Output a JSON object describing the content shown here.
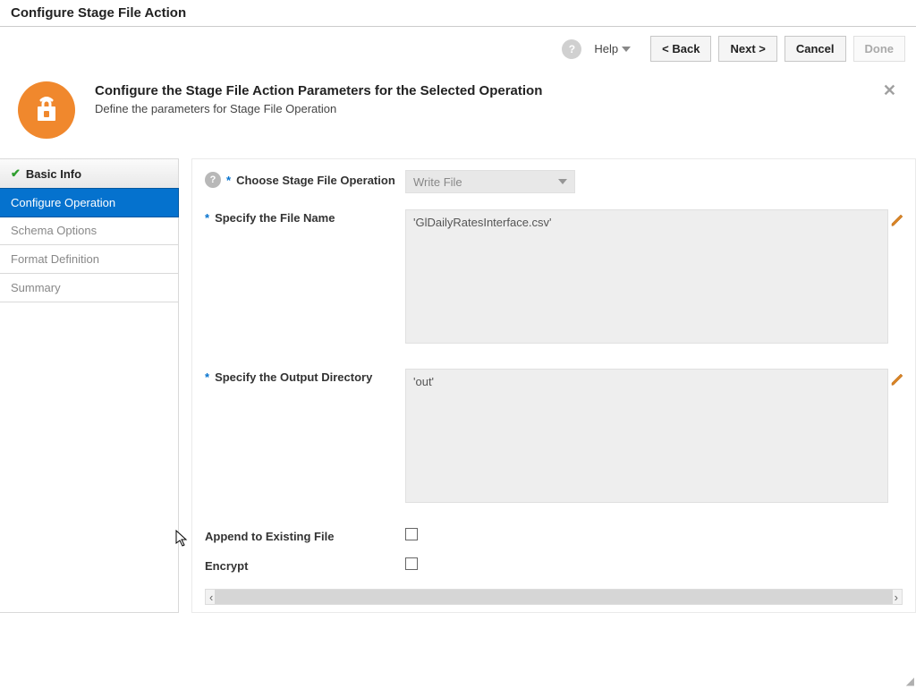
{
  "dialogTitle": "Configure Stage File Action",
  "toolbar": {
    "helpLabel": "Help",
    "backLabel": "<  Back",
    "nextLabel": "Next  >",
    "cancelLabel": "Cancel",
    "doneLabel": "Done"
  },
  "header": {
    "title": "Configure the Stage File Action Parameters for the Selected Operation",
    "subtitle": "Define the parameters for Stage File Operation"
  },
  "nav": {
    "items": [
      {
        "label": "Basic Info",
        "state": "done"
      },
      {
        "label": "Configure Operation",
        "state": "active"
      },
      {
        "label": "Schema Options",
        "state": "upcoming"
      },
      {
        "label": "Format Definition",
        "state": "upcoming"
      },
      {
        "label": "Summary",
        "state": "upcoming"
      }
    ]
  },
  "form": {
    "operationLabel": "Choose Stage File Operation",
    "operationValue": "Write File",
    "fileNameLabel": "Specify the File Name",
    "fileNameValue": "'GlDailyRatesInterface.csv'",
    "outputDirLabel": "Specify the Output Directory",
    "outputDirValue": "'out'",
    "appendLabel": "Append to Existing File",
    "appendChecked": false,
    "encryptLabel": "Encrypt",
    "encryptChecked": false
  }
}
